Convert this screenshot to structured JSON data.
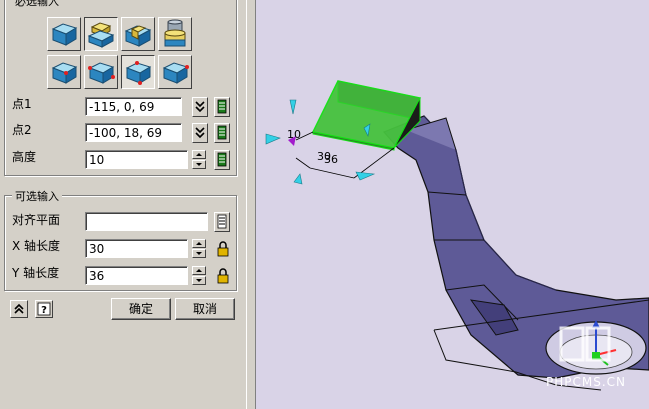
{
  "panel": {
    "required_group_title": "必选输入",
    "optional_group_title": "可选输入",
    "toolbar_row1_icons": [
      "box-solid-icon",
      "box-stack-icon",
      "box-cut-icon",
      "cylinder-stack-icon"
    ],
    "toolbar_row2_icons": [
      "box-point-icon",
      "box-two-points-icon",
      "box-corner-icon",
      "box-edge-icon"
    ],
    "point1": {
      "label": "点1",
      "value": "-115, 0, 69"
    },
    "point2": {
      "label": "点2",
      "value": "-100, 18, 69"
    },
    "height": {
      "label": "高度",
      "value": "10"
    },
    "align_plane": {
      "label": "对齐平面",
      "value": ""
    },
    "x_length": {
      "label": "X 轴长度",
      "value": "30"
    },
    "y_length": {
      "label": "Y 轴长度",
      "value": "36"
    },
    "ok_label": "确定",
    "cancel_label": "取消"
  },
  "viewport": {
    "dim_height": "10",
    "dim_x": "30",
    "dim_y": "36",
    "watermark": "PHPCMS.CN"
  },
  "colors": {
    "panel_bg": "#d4d0c8",
    "viewport_bg": "#d9d3e7",
    "part_purple": "#5e5a97",
    "preview_green": "#46c23e",
    "arrow_cyan": "#33d0e6"
  }
}
